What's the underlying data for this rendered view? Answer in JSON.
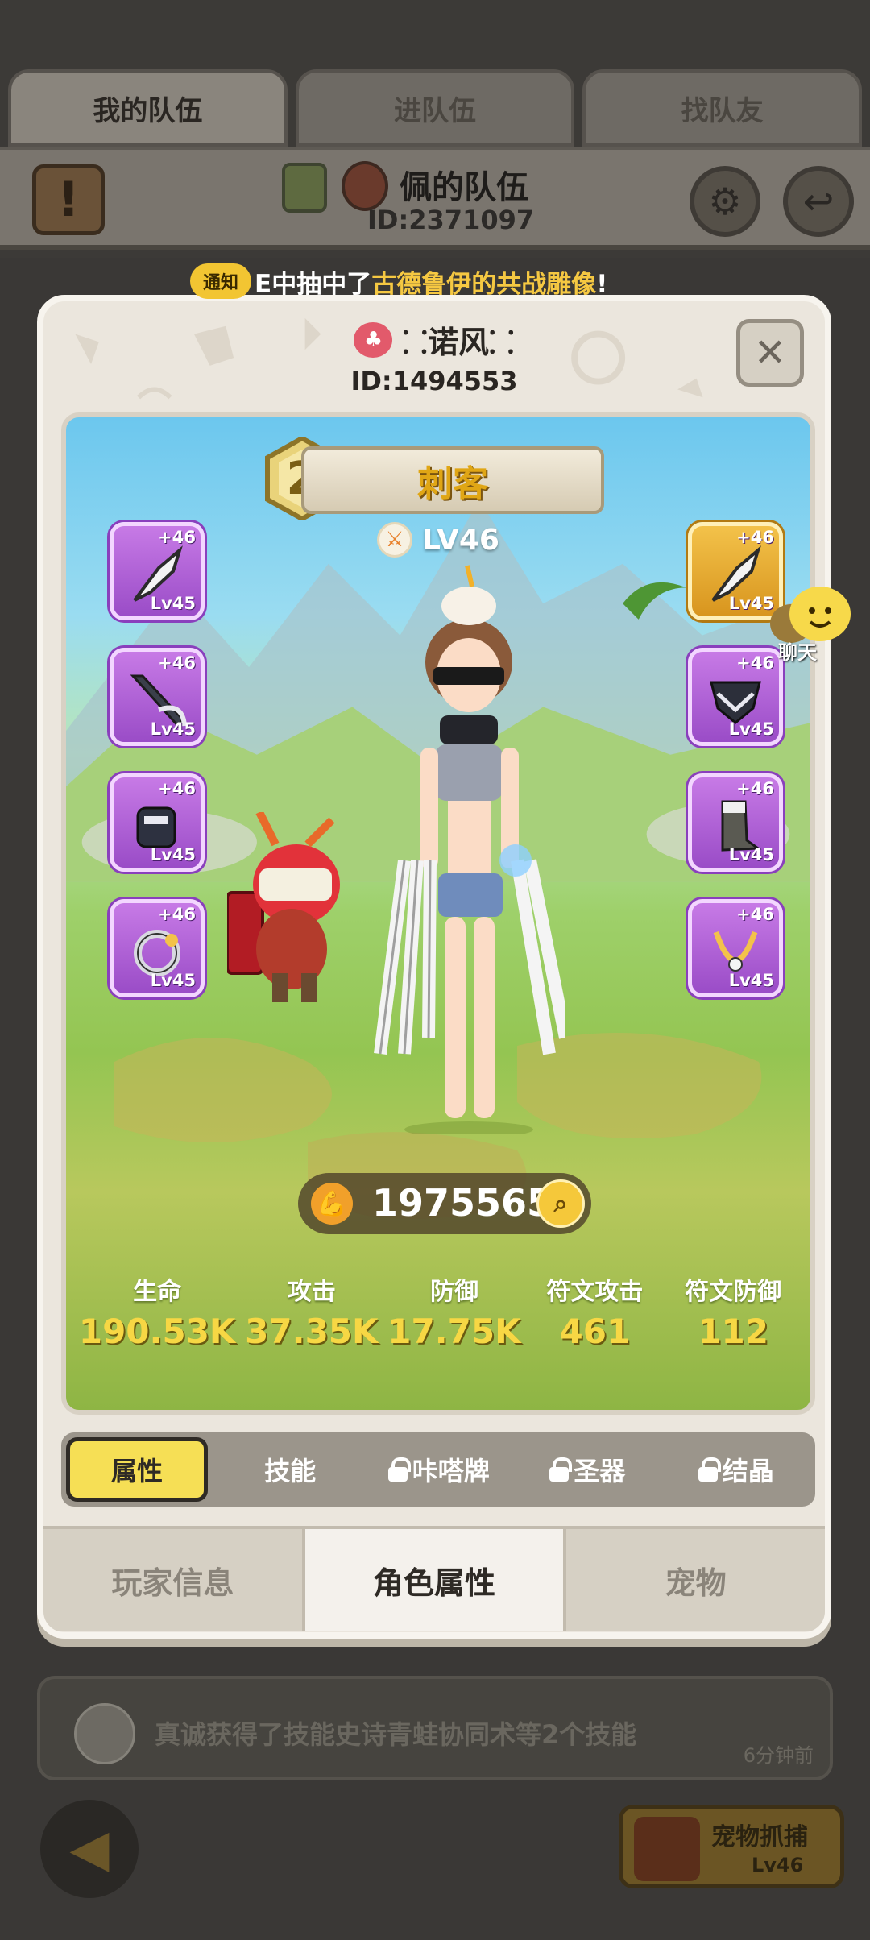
{
  "top_tabs": [
    {
      "label": "我的队伍",
      "active": true
    },
    {
      "label": "进队伍",
      "active": false
    },
    {
      "label": "找队友",
      "active": false
    }
  ],
  "team": {
    "name": "佩的队伍",
    "id": "ID:2371097"
  },
  "notice": {
    "tag": "通知",
    "prefix": "E中抽中了",
    "highlight": "古德鲁伊的共战雕像",
    "suffix": "!"
  },
  "player": {
    "name": "诺风",
    "id": "ID:1494553",
    "class_rank": "2",
    "class_name": "刺客",
    "level": "LV46"
  },
  "equipment": {
    "left": [
      {
        "plus": "+46",
        "level": "Lv45",
        "icon": "claw-weapon-icon"
      },
      {
        "plus": "+46",
        "level": "Lv45",
        "icon": "scythe-icon"
      },
      {
        "plus": "+46",
        "level": "Lv45",
        "icon": "gauntlet-icon"
      },
      {
        "plus": "+46",
        "level": "Lv45",
        "icon": "ring-icon"
      }
    ],
    "right": [
      {
        "plus": "+46",
        "level": "Lv45",
        "icon": "claw-weapon-icon"
      },
      {
        "plus": "+46",
        "level": "Lv45",
        "icon": "chest-armor-icon"
      },
      {
        "plus": "+46",
        "level": "Lv45",
        "icon": "boots-icon"
      },
      {
        "plus": "+46",
        "level": "Lv45",
        "icon": "necklace-icon"
      }
    ]
  },
  "combat_power": "1975565",
  "stats": [
    {
      "label": "生命",
      "value": "190.53K"
    },
    {
      "label": "攻击",
      "value": "37.35K"
    },
    {
      "label": "防御",
      "value": "17.75K"
    },
    {
      "label": "符文攻击",
      "value": "461"
    },
    {
      "label": "符文防御",
      "value": "112"
    }
  ],
  "sub_tabs": [
    {
      "label": "属性",
      "active": true,
      "locked": false
    },
    {
      "label": "技能",
      "active": false,
      "locked": false
    },
    {
      "label": "咔嗒牌",
      "active": false,
      "locked": true
    },
    {
      "label": "圣器",
      "active": false,
      "locked": true
    },
    {
      "label": "结晶",
      "active": false,
      "locked": true
    }
  ],
  "bottom_tabs": [
    {
      "label": "玩家信息",
      "active": false
    },
    {
      "label": "角色属性",
      "active": true
    },
    {
      "label": "宠物",
      "active": false
    }
  ],
  "chat": {
    "label": "聊天"
  },
  "feed": {
    "text": "真诚获得了技能史诗青蛙协同术等2个技能",
    "time": "6分钟前"
  },
  "pet_capture": {
    "label": "宠物抓捕",
    "level": "Lv46"
  },
  "colors": {
    "accent_yellow": "#f6df55",
    "equip_purple": "#b062d8",
    "equip_gold": "#e6a93a",
    "stat_value": "#f7d744"
  }
}
